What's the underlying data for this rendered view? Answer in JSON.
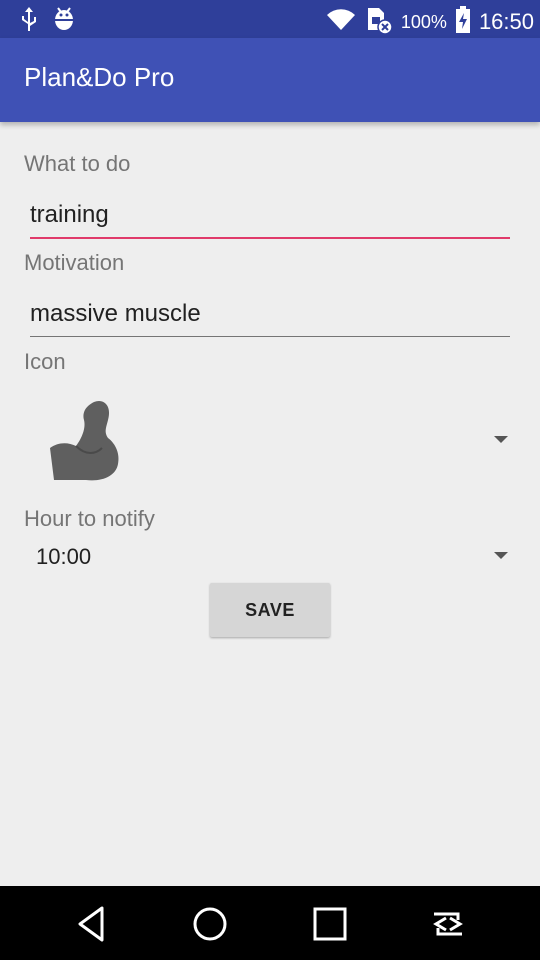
{
  "status_bar": {
    "battery_percent": "100%",
    "time": "16:50",
    "left_icons": [
      "usb-icon",
      "android-debug-icon"
    ],
    "right_icons": [
      "wifi-icon",
      "sim-no-signal-icon",
      "battery-charging-icon"
    ]
  },
  "app_bar": {
    "title": "Plan&Do Pro"
  },
  "form": {
    "what_label": "What to do",
    "what_value": "training",
    "motivation_label": "Motivation",
    "motivation_value": "massive muscle",
    "icon_label": "Icon",
    "icon_selected": "flexed-bicep-icon",
    "hour_label": "Hour to notify",
    "hour_value": "10:00",
    "save_label": "SAVE"
  },
  "nav_bar": {
    "buttons": [
      "back-icon",
      "home-icon",
      "recents-icon",
      "screen-rotate-icon"
    ]
  },
  "colors": {
    "status_bar": "#2f3f9a",
    "app_bar": "#3f51b5",
    "focus_accent": "#e03a6a",
    "background": "#eeeeee"
  }
}
